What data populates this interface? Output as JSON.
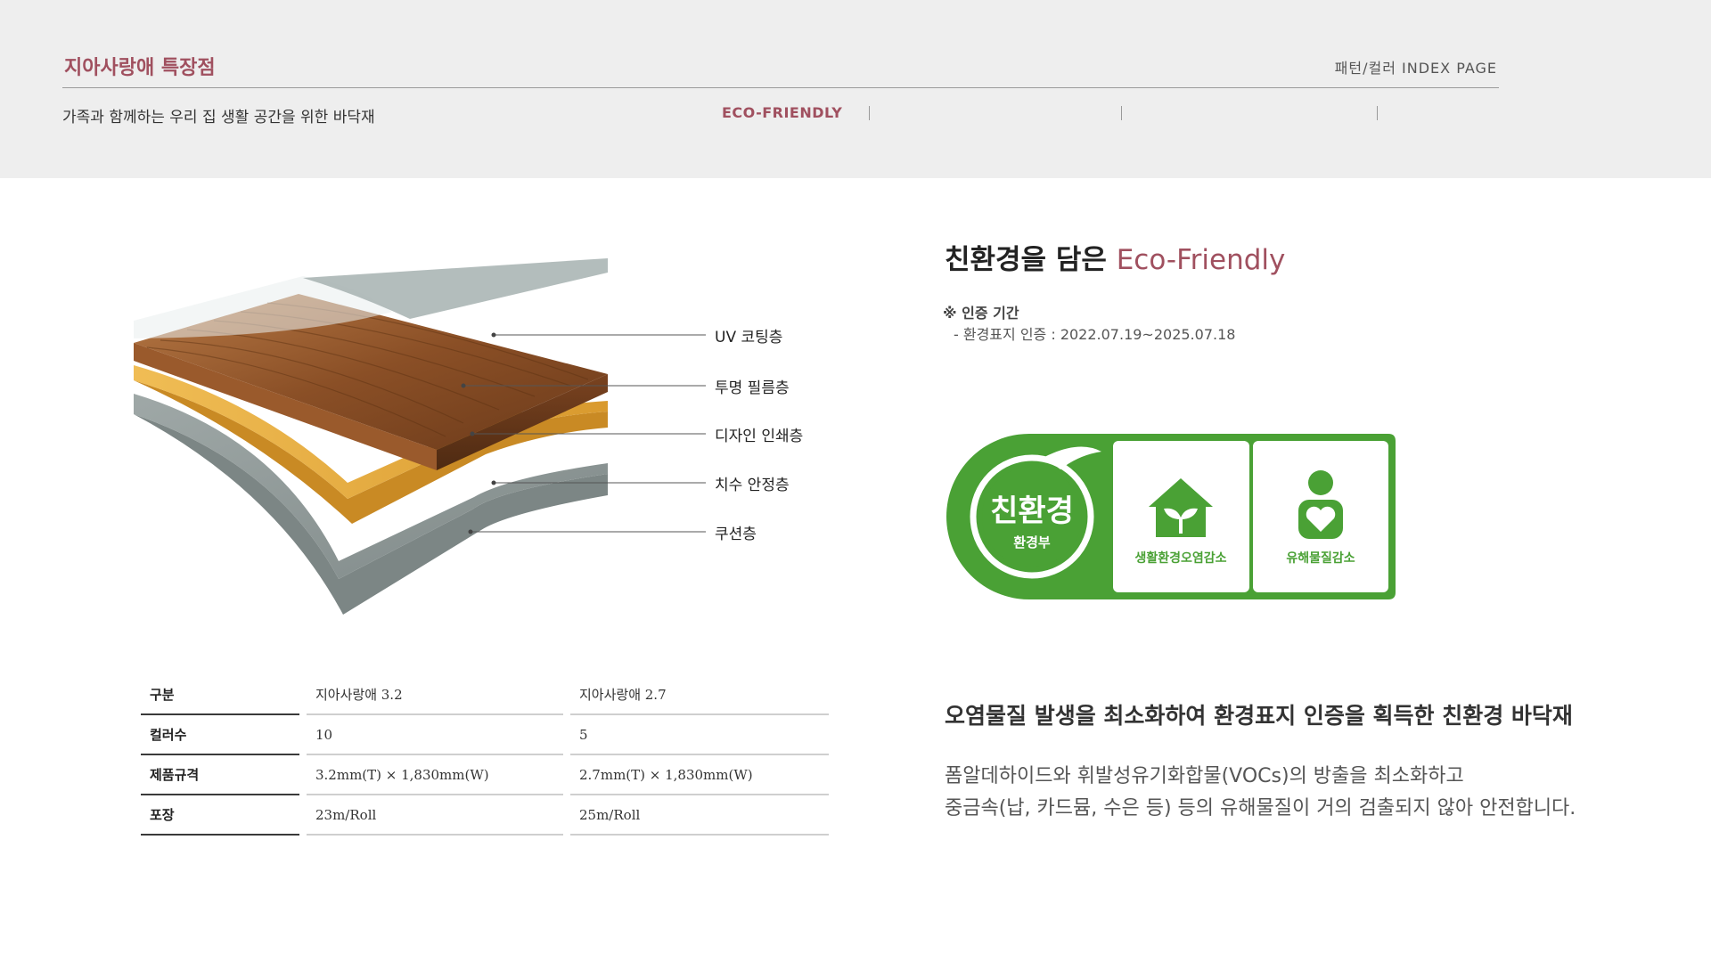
{
  "header": {
    "brand": "지아사랑애 특장점",
    "index_label": "패턴/컬러 INDEX PAGE",
    "tagline": "가족과 함께하는 우리 집 생활 공간을 위한 바닥재",
    "nav_active": "ECO-FRIENDLY"
  },
  "layers": [
    {
      "label": "UV 코팅층"
    },
    {
      "label": "투명 필름층"
    },
    {
      "label": "디자인 인쇄층"
    },
    {
      "label": "치수 안정층"
    },
    {
      "label": "쿠션층"
    }
  ],
  "specs": {
    "rows": [
      {
        "head": "구분",
        "a": "지아사랑애 3.2",
        "b": "지아사랑애 2.7"
      },
      {
        "head": "컬러수",
        "a": "10",
        "b": "5"
      },
      {
        "head": "제품규격",
        "a": "3.2mm(T) × 1,830mm(W)",
        "b": "2.7mm(T) × 1,830mm(W)"
      },
      {
        "head": "포장",
        "a": "23m/Roll",
        "b": "25m/Roll"
      }
    ]
  },
  "eco": {
    "title_main": "친환경을 담은 ",
    "title_accent": "Eco-Friendly",
    "cert_head": "※ 인증 기간",
    "cert_line": "- 환경표지 인증 : 2022.07.19~2025.07.18"
  },
  "badge": {
    "seal_text": "친환경",
    "seal_sub": "환경부",
    "item1_label": "생활환경오염감소",
    "item2_label": "유해물질감소",
    "colors": {
      "green": "#4aa135",
      "white": "#ffffff"
    }
  },
  "claim": {
    "headline": "오염물질 발생을 최소화하여 환경표지 인증을 획득한 친환경 바닥재",
    "desc_line1": "폼알데하이드와 휘발성유기화합물(VOCs)의 방출을 최소화하고",
    "desc_line2": "중금속(납, 카드뮴, 수은 등) 등의 유해물질이 거의 검출되지 않아 안전합니다."
  },
  "colors": {
    "accent": "#a0505f",
    "header_bg": "#eeeeee"
  }
}
